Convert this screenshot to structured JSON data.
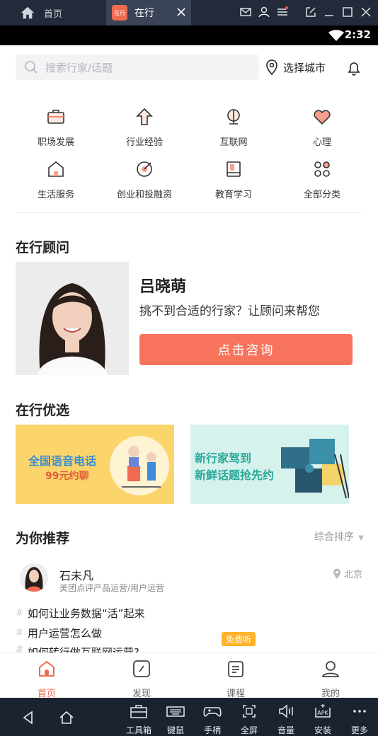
{
  "emulator": {
    "tab_home_label": "首页",
    "tab_active_label": "在行",
    "tab_active_logo": "在行",
    "time": "2:32"
  },
  "search": {
    "placeholder": "搜索行家/话题"
  },
  "city": {
    "label": "选择城市"
  },
  "categories": [
    {
      "label": "职场发展",
      "icon": "briefcase-icon"
    },
    {
      "label": "行业经验",
      "icon": "arrow-up-icon"
    },
    {
      "label": "互联网",
      "icon": "globe-icon"
    },
    {
      "label": "心理",
      "icon": "heart-icon"
    },
    {
      "label": "生活服务",
      "icon": "home-icon"
    },
    {
      "label": "创业和投融资",
      "icon": "target-icon"
    },
    {
      "label": "教育学习",
      "icon": "book-icon"
    },
    {
      "label": "全部分类",
      "icon": "grid-icon"
    }
  ],
  "consultant_section": {
    "title": "在行顾问",
    "name": "吕晓萌",
    "description": "挑不到合适的行家？让顾问来帮您",
    "button": "点击咨询"
  },
  "selection_section": {
    "title": "在行优选",
    "banner1": {
      "line1": "全国语音电话",
      "line2": "99元约聊"
    },
    "banner2": {
      "line1": "新行家驾到",
      "line2": "新鲜话题抢先约"
    }
  },
  "recommend_section": {
    "title": "为你推荐",
    "sort_label": "综合排序",
    "expert": {
      "name": "石未凡",
      "role": "美团点评产品运营/用户运营",
      "location": "北京"
    },
    "topics": [
      "如何让业务数据“活”起来",
      "用户运营怎么做",
      "如何转行做互联网运营?"
    ]
  },
  "free_badge": "免费听",
  "bottom_nav": [
    {
      "label": "首页",
      "active": true
    },
    {
      "label": "发现",
      "active": false
    },
    {
      "label": "课程",
      "active": false
    },
    {
      "label": "我的",
      "active": false
    }
  ],
  "emulator_tools": [
    "工具箱",
    "键鼠",
    "手柄",
    "全屏",
    "音量",
    "安装",
    "更多"
  ],
  "colors": {
    "accent": "#f06a4f",
    "button": "#f7735b",
    "banner1": "#fbd56b",
    "banner2": "#d6f2ec"
  }
}
